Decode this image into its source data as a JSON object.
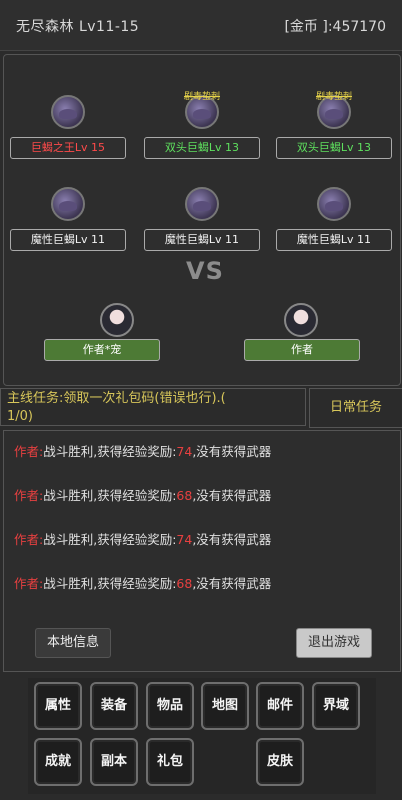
{
  "header": {
    "area": "无尽森林 Lv11-15",
    "gold": "[金币 ]:457170"
  },
  "enemies": [
    {
      "name": "巨蝎之王Lv 15",
      "skill": ""
    },
    {
      "name": "双头巨蝎Lv 13",
      "skill": "剧毒蛰刺"
    },
    {
      "name": "双头巨蝎Lv 13",
      "skill": "剧毒蛰刺"
    },
    {
      "name": "魔性巨蝎Lv 11"
    },
    {
      "name": "魔性巨蝎Lv 11"
    },
    {
      "name": "魔性巨蝎Lv 11"
    }
  ],
  "vs": "VS",
  "heroes": [
    {
      "name": "作者*宠"
    },
    {
      "name": "作者"
    }
  ],
  "quest": {
    "main_line1": "主线任务:领取一次礼包码(错误也行).(",
    "main_line2": "1/0)",
    "daily": "日常任务"
  },
  "log": [
    {
      "who": "作者:",
      "text1": "战斗胜利,获得经验奖励:",
      "exp": "74",
      "text2": ",没有获得武器"
    },
    {
      "who": "作者:",
      "text1": "战斗胜利,获得经验奖励:",
      "exp": "68",
      "text2": ",没有获得武器"
    },
    {
      "who": "作者:",
      "text1": "战斗胜利,获得经验奖励:",
      "exp": "74",
      "text2": ",没有获得武器"
    },
    {
      "who": "作者:",
      "text1": "战斗胜利,获得经验奖励:",
      "exp": "68",
      "text2": ",没有获得武器"
    }
  ],
  "buttons": {
    "local": "本地信息",
    "exit": "退出游戏"
  },
  "menu": [
    "属性",
    "装备",
    "物品",
    "地图",
    "邮件",
    "界域",
    "成就",
    "副本",
    "礼包",
    "皮肤"
  ]
}
